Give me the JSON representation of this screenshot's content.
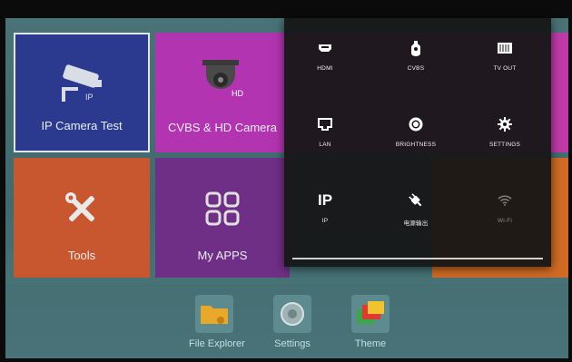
{
  "tiles": {
    "ip_camera_test": "IP Camera Test",
    "cvbs_hd_camera": "CVBS & HD Camera",
    "cvbs_badge": "HD",
    "ip_badge": "IP",
    "tools": "Tools",
    "my_apps": "My APPS"
  },
  "dock": {
    "file_explorer": "File Explorer",
    "settings": "Settings",
    "theme": "Theme"
  },
  "quick_settings": [
    {
      "label": "HDMI",
      "icon": "hdmi-icon",
      "active": true
    },
    {
      "label": "CVBS",
      "icon": "cvbs-icon",
      "active": true
    },
    {
      "label": "TV OUT",
      "icon": "tv-out-icon",
      "active": true
    },
    {
      "label": "LAN",
      "icon": "lan-icon",
      "active": true
    },
    {
      "label": "BRIGHTNESS",
      "icon": "brightness-icon",
      "active": true
    },
    {
      "label": "SETTINGS",
      "icon": "settings-gear-icon",
      "active": true
    },
    {
      "label": "IP",
      "icon_text": "IP",
      "icon": "ip-icon",
      "active": true
    },
    {
      "label": "电源输出",
      "icon": "power-plug-icon",
      "active": true
    },
    {
      "label": "Wi-Fi",
      "icon": "wifi-icon",
      "active": false
    }
  ],
  "colors": {
    "ip_tile": "#2b3a8f",
    "cvbs_tile": "#b334b0",
    "tools_tile": "#c8562f",
    "apps_tile": "#6f2f86",
    "panel_bg": "#161616"
  }
}
